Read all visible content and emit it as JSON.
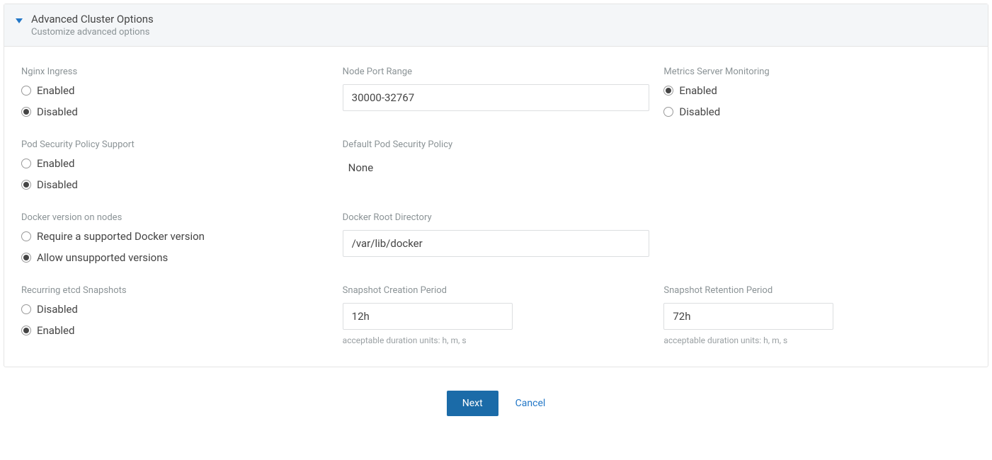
{
  "header": {
    "title": "Advanced Cluster Options",
    "subtitle": "Customize advanced options"
  },
  "labels": {
    "enabled": "Enabled",
    "disabled": "Disabled"
  },
  "nginx": {
    "label": "Nginx Ingress",
    "selected": "disabled"
  },
  "nodePort": {
    "label": "Node Port Range",
    "value": "30000-32767"
  },
  "metrics": {
    "label": "Metrics Server Monitoring",
    "selected": "enabled"
  },
  "podSecurity": {
    "label": "Pod Security Policy Support",
    "selected": "disabled"
  },
  "defaultPodPolicy": {
    "label": "Default Pod Security Policy",
    "value": "None"
  },
  "dockerVersion": {
    "label": "Docker version on nodes",
    "opt_require": "Require a supported Docker version",
    "opt_allow": "Allow unsupported versions",
    "selected": "allow"
  },
  "dockerRoot": {
    "label": "Docker Root Directory",
    "value": "/var/lib/docker"
  },
  "etcdSnapshots": {
    "label": "Recurring etcd Snapshots",
    "selected": "enabled"
  },
  "snapshotCreation": {
    "label": "Snapshot Creation Period",
    "value": "12h",
    "hint": "acceptable duration units: h, m, s"
  },
  "snapshotRetention": {
    "label": "Snapshot Retention Period",
    "value": "72h",
    "hint": "acceptable duration units: h, m, s"
  },
  "footer": {
    "next": "Next",
    "cancel": "Cancel"
  }
}
